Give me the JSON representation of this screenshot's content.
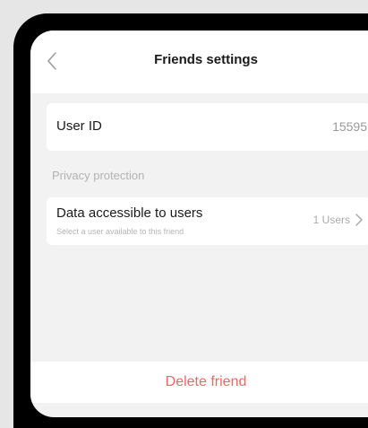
{
  "header": {
    "title": "Friends settings",
    "back_icon": "chevron-left-icon"
  },
  "user_id": {
    "label": "User ID",
    "value": "15595"
  },
  "privacy": {
    "section_label": "Privacy protection",
    "data_access": {
      "title": "Data accessible to users",
      "subtitle": "Select a user available to this friend",
      "count": "1 Users",
      "icon": "chevron-right-icon"
    }
  },
  "actions": {
    "delete_label": "Delete friend"
  },
  "colors": {
    "danger": "#f06666",
    "background": "#f2f2f2",
    "frame": "#000000",
    "page": "#e6e6e6"
  }
}
